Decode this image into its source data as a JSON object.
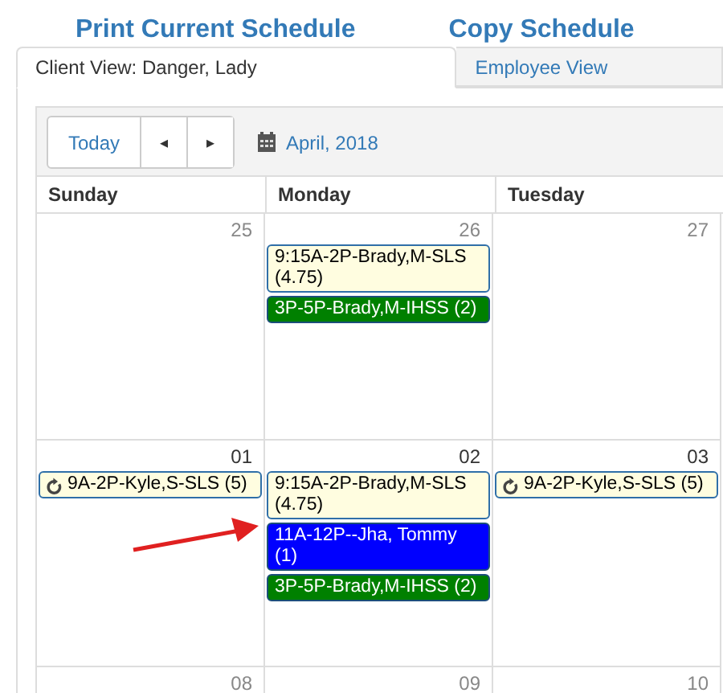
{
  "links": [
    "Print Current Schedule",
    "Copy Schedule"
  ],
  "tabs": [
    {
      "label": "Client View: Danger, Lady",
      "selected": true
    },
    {
      "label": "Employee View",
      "selected": false
    }
  ],
  "toolbar": {
    "today": "Today",
    "prev": "◂",
    "next": "▸",
    "month": "April, 2018"
  },
  "calendar": {
    "days": [
      "Sunday",
      "Monday",
      "Tuesday"
    ],
    "weeks": [
      {
        "cells": [
          {
            "date": "25"
          },
          {
            "date": "26",
            "events": [
              {
                "kind": "plain",
                "color": "#fffde0",
                "text": "9:15A-2P-Brady,M-SLS (4.75)"
              },
              {
                "kind": "plain",
                "color": "#008000",
                "text": "3P-5P-Brady,M-IHSS (2)"
              }
            ]
          },
          {
            "date": "27"
          }
        ]
      },
      {
        "cells": [
          {
            "date": "01",
            "events": [
              {
                "kind": "repeat",
                "color": "#fffde0",
                "text": "9A-2P-Kyle,S-SLS (5)"
              }
            ]
          },
          {
            "date": "02",
            "events": [
              {
                "kind": "plain",
                "color": "#fffde0",
                "text": "9:15A-2P-Brady,M-SLS (4.75)"
              },
              {
                "kind": "plain",
                "color": "#0000ff",
                "text": "11A-12P--Jha, Tommy (1)"
              },
              {
                "kind": "plain",
                "color": "#008000",
                "text": "3P-5P-Brady,M-IHSS (2)"
              }
            ]
          },
          {
            "date": "03",
            "events": [
              {
                "kind": "repeat",
                "color": "#fffde0",
                "text": "9A-2P-Kyle,S-SLS (5)"
              }
            ]
          }
        ]
      },
      {
        "cells": [
          {
            "date": "08"
          },
          {
            "date": "09"
          },
          {
            "date": "10"
          }
        ]
      }
    ]
  }
}
